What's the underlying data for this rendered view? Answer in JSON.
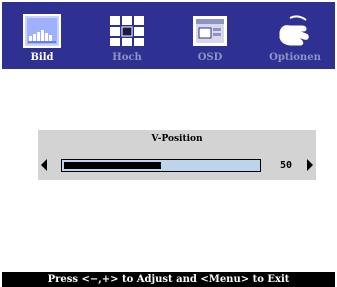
{
  "tabs": [
    {
      "label": "Bild",
      "icon": "picture-icon",
      "active": true
    },
    {
      "label": "Hoch",
      "icon": "tiles-icon",
      "active": false
    },
    {
      "label": "OSD",
      "icon": "osd-screen-icon",
      "active": false
    },
    {
      "label": "Optionen",
      "icon": "options-hand-icon",
      "active": false
    }
  ],
  "adjust": {
    "title": "V-Position",
    "value": "50",
    "level_percent": 50
  },
  "status": {
    "text": "Press <−,+> to Adjust and <Menu> to Exit"
  },
  "colors": {
    "menu_bar": "#2f3192",
    "active_label": "#ffffff",
    "inactive_label": "#8f93c6",
    "panel": "#d3d3d3",
    "track": "#bcd4ec"
  }
}
